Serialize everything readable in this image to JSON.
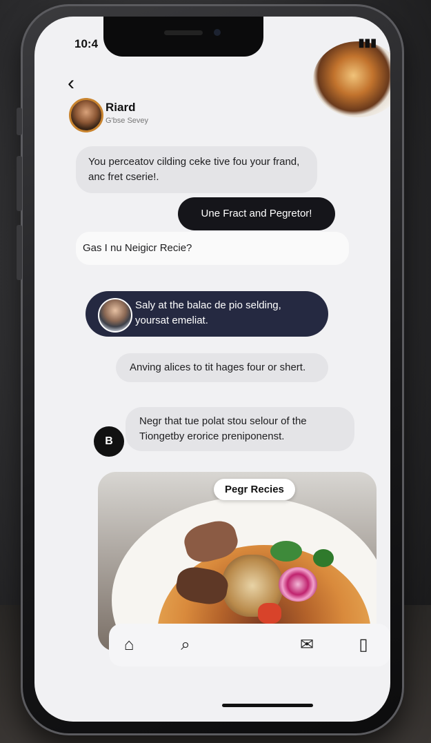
{
  "status": {
    "time": "10:4",
    "icons": "wifi signal battery"
  },
  "header": {
    "back_label": "‹",
    "contact_name": "Riard",
    "contact_status": "G'bse Sevey"
  },
  "messages": [
    {
      "side": "incoming",
      "text": "You perceatov cilding ceke tive fou your frand, anc fret cserie!."
    },
    {
      "side": "outgoing",
      "text": "Une Fract and Pegretor!"
    },
    {
      "side": "incoming",
      "text": "Gas I nu Neigicr Recie?"
    },
    {
      "side": "incoming-highlight",
      "text": "Saly at the balac de pio selding, yoursat emeliat."
    },
    {
      "side": "incoming",
      "text": "Anving alices to tit hages four or shert."
    },
    {
      "side": "incoming",
      "text": "Negr that tue polat stou selour of the Tiongetby erorice preniponenst."
    }
  ],
  "avatar_letter": "B",
  "recipe_card": {
    "chip_label": "Pegr Recies"
  },
  "tabbar": {
    "icons": [
      "home-icon",
      "search-icon",
      "mail-icon",
      "bookmark-icon"
    ]
  }
}
